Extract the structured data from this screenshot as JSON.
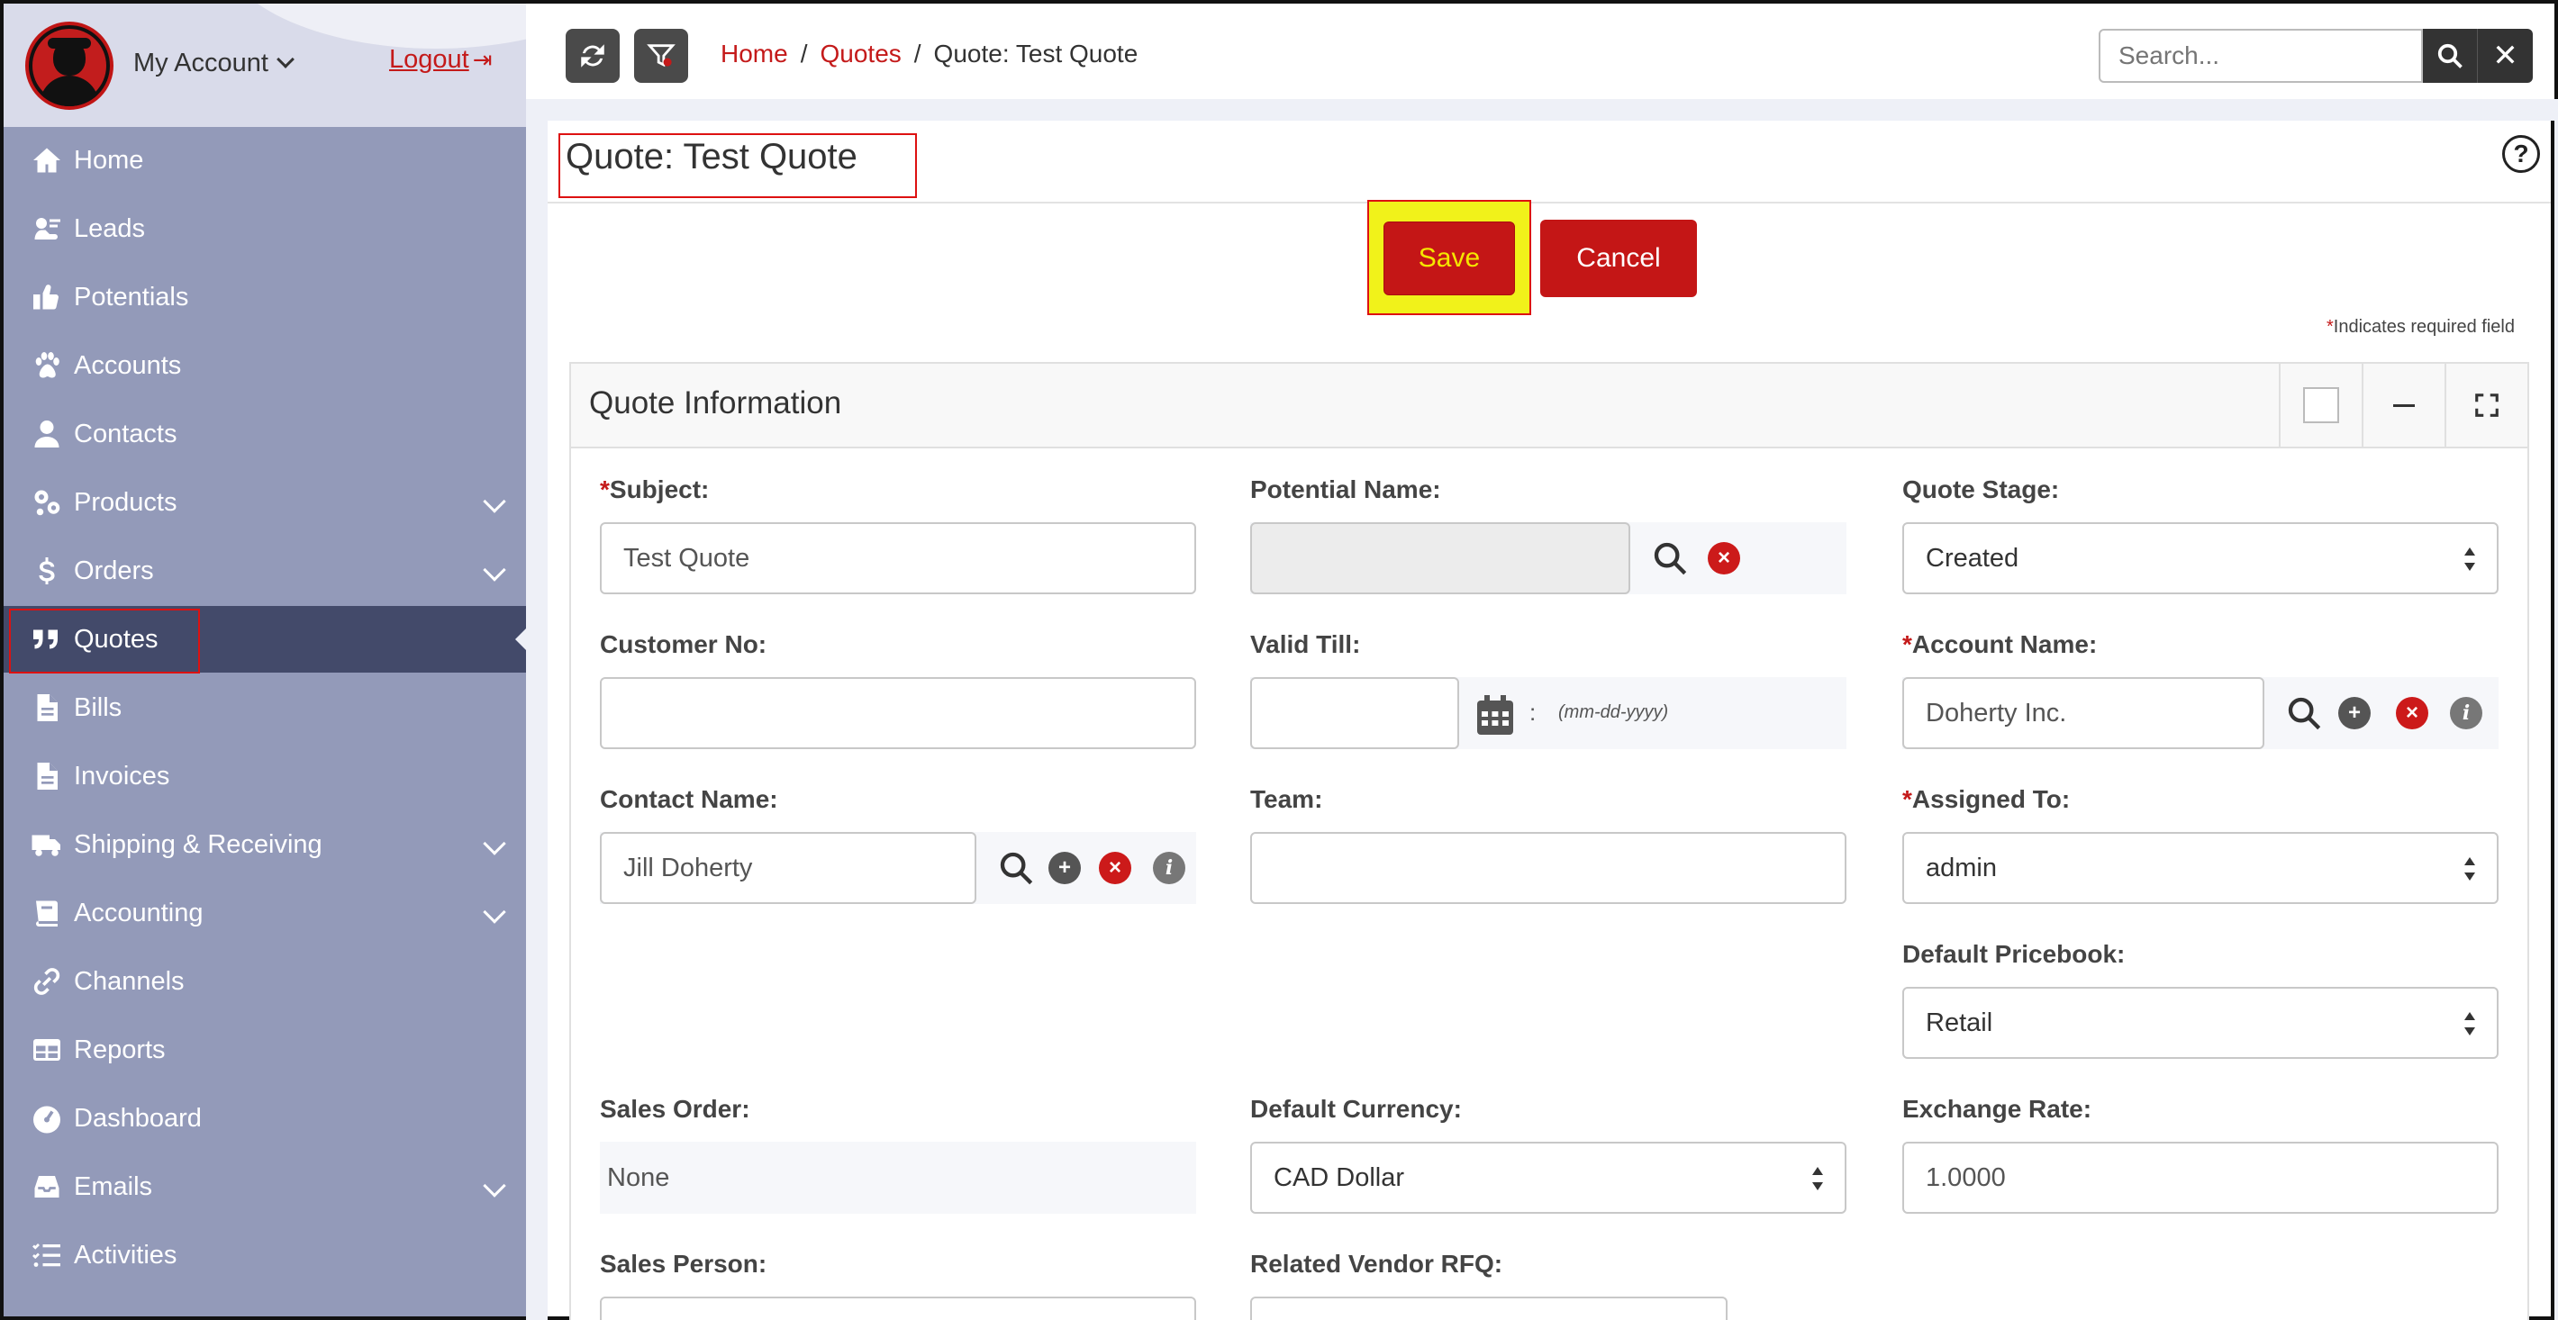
{
  "account": {
    "label": "My Account",
    "logout": "Logout"
  },
  "nav": [
    {
      "label": "Home",
      "icon": "home-icon"
    },
    {
      "label": "Leads",
      "icon": "leads-icon"
    },
    {
      "label": "Potentials",
      "icon": "thumbs-up-icon"
    },
    {
      "label": "Accounts",
      "icon": "paw-icon"
    },
    {
      "label": "Contacts",
      "icon": "user-icon"
    },
    {
      "label": "Products",
      "icon": "gears-icon",
      "expandable": true
    },
    {
      "label": "Orders",
      "icon": "dollar-icon",
      "expandable": true
    },
    {
      "label": "Quotes",
      "icon": "quote-icon",
      "active": true
    },
    {
      "label": "Bills",
      "icon": "file-icon"
    },
    {
      "label": "Invoices",
      "icon": "file-icon"
    },
    {
      "label": "Shipping & Receiving",
      "icon": "truck-icon",
      "expandable": true
    },
    {
      "label": "Accounting",
      "icon": "book-icon",
      "expandable": true
    },
    {
      "label": "Channels",
      "icon": "link-icon"
    },
    {
      "label": "Reports",
      "icon": "table-icon"
    },
    {
      "label": "Dashboard",
      "icon": "gauge-icon"
    },
    {
      "label": "Emails",
      "icon": "inbox-icon",
      "expandable": true
    },
    {
      "label": "Activities",
      "icon": "list-icon"
    }
  ],
  "breadcrumb": {
    "home": "Home",
    "quotes": "Quotes",
    "current": "Quote: Test Quote",
    "sep": "/"
  },
  "search": {
    "placeholder": "Search..."
  },
  "page": {
    "title": "Quote: Test Quote",
    "save": "Save",
    "cancel": "Cancel",
    "required_star": "*",
    "required_note": "Indicates required field"
  },
  "panel": {
    "title": "Quote Information",
    "fields": {
      "subject": {
        "label": "Subject:",
        "required": "*",
        "value": "Test Quote"
      },
      "potential_name": {
        "label": "Potential Name:",
        "value": ""
      },
      "quote_stage": {
        "label": "Quote Stage:",
        "value": "Created"
      },
      "customer_no": {
        "label": "Customer No:",
        "value": ""
      },
      "valid_till": {
        "label": "Valid Till:",
        "value": "",
        "sep": ":",
        "hint": "(mm-dd-yyyy)"
      },
      "account_name": {
        "label": "Account Name:",
        "required": "*",
        "value": "Doherty Inc."
      },
      "contact_name": {
        "label": "Contact Name:",
        "value": "Jill Doherty"
      },
      "team": {
        "label": "Team:",
        "value": ""
      },
      "assigned_to": {
        "label": "Assigned To:",
        "required": "*",
        "value": "admin"
      },
      "default_pricebook": {
        "label": "Default Pricebook:",
        "value": "Retail"
      },
      "sales_order": {
        "label": "Sales Order:",
        "value": "None"
      },
      "default_currency": {
        "label": "Default Currency:",
        "value": "CAD Dollar"
      },
      "exchange_rate": {
        "label": "Exchange Rate:",
        "value": "1.0000"
      },
      "sales_person": {
        "label": "Sales Person:"
      },
      "related_vendor_rfq": {
        "label": "Related Vendor RFQ:"
      }
    }
  },
  "colors": {
    "accent": "#c41a1a",
    "sidebar": "#939ab9",
    "sidebar_active": "#434a6a",
    "save_highlight": "#f1f21a"
  }
}
